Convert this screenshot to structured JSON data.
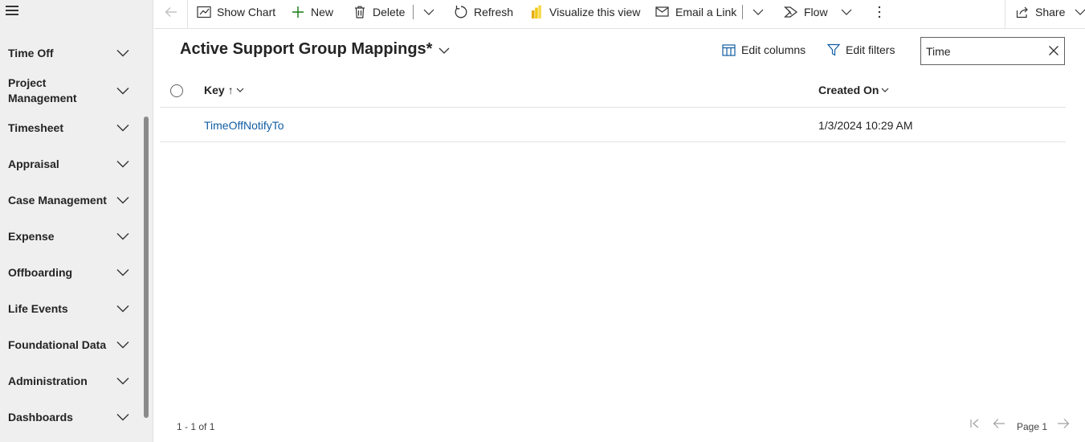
{
  "sidebar": {
    "items": [
      {
        "label": "Time Off"
      },
      {
        "label": "Project Management"
      },
      {
        "label": "Timesheet"
      },
      {
        "label": "Appraisal"
      },
      {
        "label": "Case Management"
      },
      {
        "label": "Expense"
      },
      {
        "label": "Offboarding"
      },
      {
        "label": "Life Events"
      },
      {
        "label": "Foundational Data"
      },
      {
        "label": "Administration"
      },
      {
        "label": "Dashboards"
      }
    ]
  },
  "toolbar": {
    "show_chart": "Show Chart",
    "new": "New",
    "delete": "Delete",
    "refresh": "Refresh",
    "visualize": "Visualize this view",
    "email_link": "Email a Link",
    "flow": "Flow",
    "share": "Share"
  },
  "view": {
    "title": "Active Support Group Mappings*",
    "edit_columns": "Edit columns",
    "edit_filters": "Edit filters",
    "search_value": "Time"
  },
  "grid": {
    "columns": [
      {
        "label": "Key",
        "sort": "↑"
      },
      {
        "label": "Created On"
      }
    ],
    "rows": [
      {
        "key": "TimeOffNotifyTo",
        "created_on": "1/3/2024 10:29 AM"
      }
    ]
  },
  "footer": {
    "record_count": "1 - 1 of 1",
    "page_label": "Page 1"
  },
  "colors": {
    "link": "#115ea3",
    "sidebar_bg": "#efefef",
    "powerbi_yellow": "#f2c811"
  }
}
